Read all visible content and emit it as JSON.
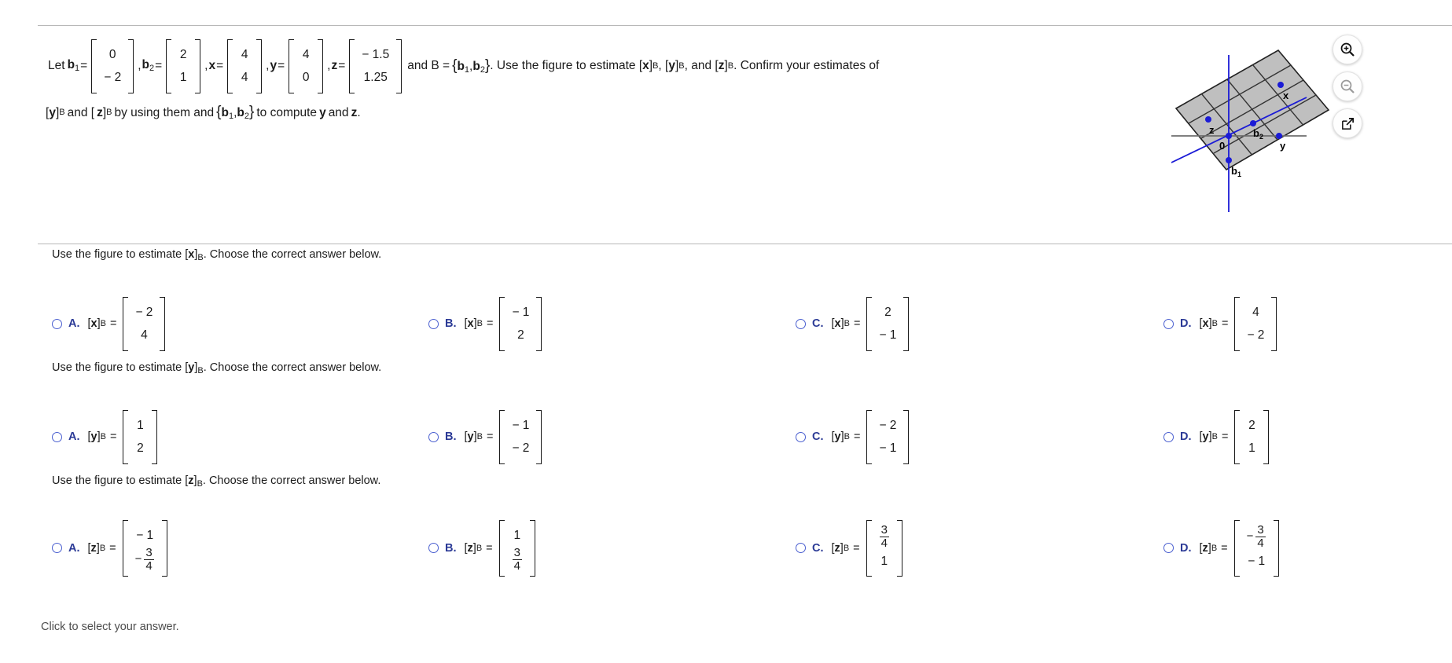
{
  "problem": {
    "intro": "Let",
    "b1_label": "b",
    "b1_sub": "1",
    "b1_vector": [
      "0",
      "− 2"
    ],
    "b2_label": "b",
    "b2_sub": "2",
    "b2_vector": [
      "2",
      "1"
    ],
    "x_label": "x",
    "x_vector": [
      "4",
      "4"
    ],
    "y_label": "y",
    "y_vector": [
      "4",
      "0"
    ],
    "z_label": "z",
    "z_vector": [
      "− 1.5",
      "1.25"
    ],
    "and_B_equals": "and B =",
    "basis_open": "{",
    "basis_b1": "b",
    "basis_b1_sub": "1",
    "basis_comma": ",",
    "basis_b2": "b",
    "basis_b2_sub": "2",
    "basis_close": "}",
    "line1_tail_a": ". Use the figure to estimate [",
    "line1_tail_x": "x",
    "line1_tail_b1": "]",
    "line1_sub_B": "B",
    "line1_tail_c": ", [",
    "line1_tail_y": "y",
    "line1_tail_d": ", and [",
    "line1_tail_z": "z",
    "line1_tail_e": ". Confirm your estimates of",
    "line2_a": "[",
    "line2_y": "y",
    "line2_b": "]",
    "line2_c": "and [",
    "line2_z": "z",
    "line2_d": "by using them and",
    "line2_e": "to compute",
    "line2_f": "and",
    "line2_g": ".",
    "sub_B": "B",
    "period": "."
  },
  "figure": {
    "alt_name": "basis-plane-figure",
    "axis_labels": {
      "x": "x",
      "y": "y",
      "z": "z",
      "origin": "0",
      "b1": "b",
      "b1_sub": "1",
      "b2": "b",
      "b2_sub": "2"
    },
    "grid_color": "#bfbfbf",
    "grid_line_color": "#333333",
    "point_color": "#1b1bd6",
    "axis_color": "#6e6e6e"
  },
  "toolbar": {
    "zoom_in": "zoom-in",
    "zoom_out": "zoom-out",
    "open_popup": "open-in-new-window"
  },
  "questions": [
    {
      "prompt_a": "Use the figure to estimate [",
      "prompt_var": "x",
      "prompt_b": "]",
      "prompt_sub": "B",
      "prompt_c": ". Choose the correct answer below.",
      "var": "x",
      "options": [
        {
          "letter": "A.",
          "values": [
            "− 2",
            "4"
          ]
        },
        {
          "letter": "B.",
          "values": [
            "− 1",
            "2"
          ]
        },
        {
          "letter": "C.",
          "values": [
            "2",
            "− 1"
          ]
        },
        {
          "letter": "D.",
          "values": [
            "4",
            "− 2"
          ]
        }
      ]
    },
    {
      "prompt_a": "Use the figure to estimate [",
      "prompt_var": "y",
      "prompt_b": "]",
      "prompt_sub": "B",
      "prompt_c": ". Choose the correct answer below.",
      "var": "y",
      "options": [
        {
          "letter": "A.",
          "values": [
            "1",
            "2"
          ]
        },
        {
          "letter": "B.",
          "values": [
            "− 1",
            "− 2"
          ]
        },
        {
          "letter": "C.",
          "values": [
            "− 2",
            "− 1"
          ]
        },
        {
          "letter": "D.",
          "values": [
            "2",
            "1"
          ]
        }
      ]
    },
    {
      "prompt_a": "Use the figure to estimate [",
      "prompt_var": "z",
      "prompt_b": "]",
      "prompt_sub": "B",
      "prompt_c": ". Choose the correct answer below.",
      "var": "z",
      "options": [
        {
          "letter": "A.",
          "values": [
            "− 1",
            {
              "sign": "−",
              "num": "3",
              "den": "4"
            }
          ]
        },
        {
          "letter": "B.",
          "values": [
            "1",
            {
              "sign": "",
              "num": "3",
              "den": "4"
            }
          ]
        },
        {
          "letter": "C.",
          "values": [
            {
              "sign": "",
              "num": "3",
              "den": "4"
            },
            "1"
          ]
        },
        {
          "letter": "D.",
          "values": [
            {
              "sign": "−",
              "num": "3",
              "den": "4"
            },
            "− 1"
          ]
        }
      ]
    }
  ],
  "footer": {
    "note": "Click to select your answer."
  },
  "colors": {
    "accent_blue": "#2b3a96",
    "radio_blue": "#4a5fd0",
    "rule_gray": "#b8b8b8",
    "figure_blue": "#1b1bd6",
    "figure_fill": "#bfbfbf"
  }
}
